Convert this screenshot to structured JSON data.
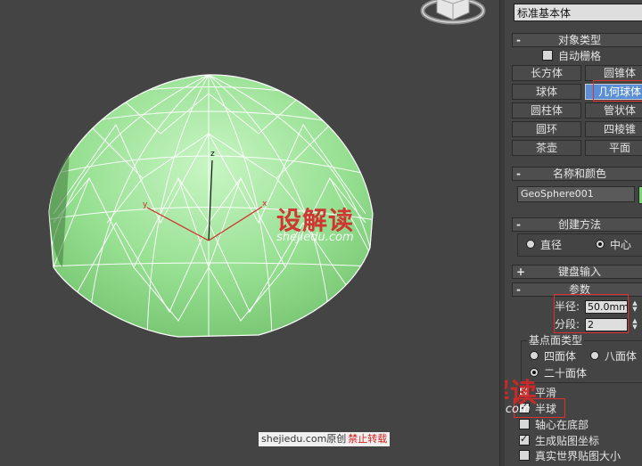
{
  "viewport": {
    "axis_labels": {
      "x": "x",
      "y": "y",
      "z": "z"
    },
    "watermark": {
      "main": "设解读",
      "sub": "shejiedu.com"
    },
    "credit": {
      "site": "shejiedu.com",
      "original": "原创",
      "no_repost": "禁止转载"
    }
  },
  "panel": {
    "category_dropdown": "标准基本体",
    "object_type": {
      "title": "对象类型",
      "collapse": "-",
      "autogrid_label": "自动栅格",
      "autogrid_checked": false,
      "buttons": [
        {
          "label": "长方体",
          "active": false
        },
        {
          "label": "圆锥体",
          "active": false
        },
        {
          "label": "球体",
          "active": false
        },
        {
          "label": "几何球体",
          "active": true
        },
        {
          "label": "圆柱体",
          "active": false
        },
        {
          "label": "管状体",
          "active": false
        },
        {
          "label": "圆环",
          "active": false
        },
        {
          "label": "四棱锥",
          "active": false
        },
        {
          "label": "茶壶",
          "active": false
        },
        {
          "label": "平面",
          "active": false
        }
      ]
    },
    "name_color": {
      "title": "名称和颜色",
      "collapse": "-",
      "name_value": "GeoSphere001",
      "color": "#7cd675"
    },
    "creation_method": {
      "title": "创建方法",
      "collapse": "-",
      "option_diameter": "直径",
      "option_center": "中心",
      "selected": "center"
    },
    "keyboard_entry": {
      "title": "键盘输入",
      "collapse": "+"
    },
    "parameters": {
      "title": "参数",
      "collapse": "-",
      "radius_label": "半径:",
      "radius_value": "50.0mm",
      "segments_label": "分段:",
      "segments_value": "2",
      "geodesic_group_title": "基点面类型",
      "option_tetra": "四面体",
      "option_octa": "八面体",
      "option_icosa": "二十面体",
      "selected_type": "icosa",
      "smooth_label": "平滑",
      "smooth_checked": true,
      "hemisphere_label": "半球",
      "hemisphere_checked": true,
      "base_pivot_label": "轴心在底部",
      "base_pivot_checked": false,
      "gen_map_label": "生成贴图坐标",
      "gen_map_checked": true,
      "real_world_label": "真实世界贴图大小",
      "real_world_checked": false
    },
    "watermark": {
      "main": "设解读",
      "sub": "shejiedu.com"
    }
  }
}
